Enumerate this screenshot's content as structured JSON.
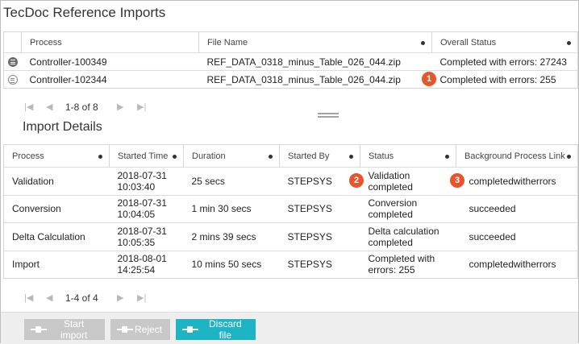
{
  "page": {
    "title": "TecDoc Reference Imports"
  },
  "imports": {
    "columns": [
      "Process",
      "File Name",
      "Overall Status"
    ],
    "rows": [
      {
        "icon": "collapsed-row-icon",
        "process": "Controller-100349",
        "file": "REF_DATA_0318_minus_Table_026_044.zip",
        "status": "Completed with errors: 27243"
      },
      {
        "icon": "selected-row-icon",
        "process": "Controller-102344",
        "file": "REF_DATA_0318_minus_Table_026_044.zip",
        "status": "Completed with errors: 255"
      }
    ],
    "pager": {
      "first": "|◀",
      "prev": "◀",
      "range": "1-8 of 8",
      "next": "▶",
      "last": "▶|"
    }
  },
  "callouts": {
    "one": "1",
    "two": "2",
    "three": "3"
  },
  "details": {
    "title": "Import Details",
    "columns": [
      "Process",
      "Started Time",
      "Duration",
      "Started By",
      "Status",
      "Background Process Link"
    ],
    "rows": [
      {
        "process": "Validation",
        "time": "2018-07-31 10:03:40",
        "duration": "25 secs",
        "by": "STEPSYS",
        "status": "Validation completed",
        "link": "completedwitherrors"
      },
      {
        "process": "Conversion",
        "time": "2018-07-31 10:04:05",
        "duration": "1 min 30 secs",
        "by": "STEPSYS",
        "status": "Conversion completed",
        "link": "succeeded"
      },
      {
        "process": "Delta Calculation",
        "time": "2018-07-31 10:05:35",
        "duration": "2 mins 39 secs",
        "by": "STEPSYS",
        "status": "Delta calculation completed",
        "link": "succeeded"
      },
      {
        "process": "Import",
        "time": "2018-08-01 14:25:54",
        "duration": "10 mins 50 secs",
        "by": "STEPSYS",
        "status": "Completed with errors: 255",
        "link": "completedwitherrors"
      }
    ],
    "pager": {
      "first": "|◀",
      "prev": "◀",
      "range": "1-4 of 4",
      "next": "▶",
      "last": "▶|"
    }
  },
  "actions": {
    "start": "Start import",
    "reject": "Reject",
    "discard": "Discard file"
  },
  "colors": {
    "accent": "#1fb3c6",
    "callout": "#e8542b",
    "link": "#1e6fa3"
  }
}
